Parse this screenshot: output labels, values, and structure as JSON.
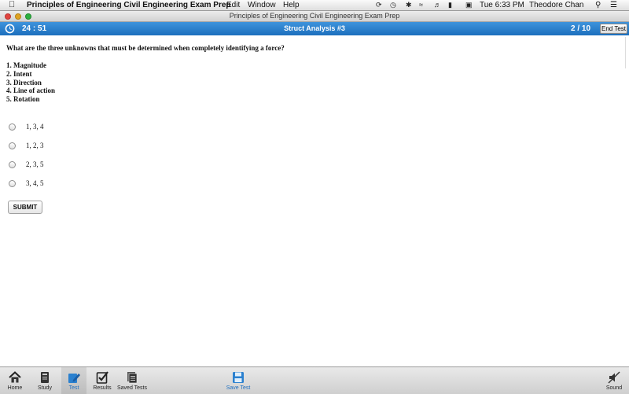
{
  "menubar": {
    "app_name": "Principles of Engineering Civil Engineering Exam Prep",
    "menus": [
      "Edit",
      "Window",
      "Help"
    ],
    "clock": "Tue 6:33 PM",
    "user": "Theodore Chan"
  },
  "window": {
    "title": "Principles of Engineering Civil Engineering Exam Prep"
  },
  "header": {
    "timer": "24 : 51",
    "title": "Struct Analysis #3",
    "progress": "2 / 10",
    "end_test_label": "End Test"
  },
  "question": {
    "text": "What are the three unknowns that must be determined when completely identifying a force?",
    "statements": [
      "1. Magnitude",
      "2. Intent",
      "3. Direction",
      "4. Line of action",
      "5. Rotation"
    ],
    "options": [
      "1, 3, 4",
      "1, 2, 3",
      "2, 3, 5",
      "3, 4, 5"
    ],
    "submit_label": "SUBMIT"
  },
  "toolbar": {
    "home": "Home",
    "study": "Study",
    "test": "Test",
    "results": "Results",
    "saved_tests": "Saved Tests",
    "save_test": "Save Test",
    "sound": "Sound"
  },
  "icons": {
    "apple": "apple-icon",
    "clock": "clock-icon",
    "home": "home-icon",
    "study": "book-icon",
    "test": "pencil-icon",
    "results": "checklist-icon",
    "saved_tests": "documents-icon",
    "save_test": "floppy-icon",
    "sound": "speaker-muted-icon"
  },
  "colors": {
    "header_blue": "#2a80cf",
    "active_blue": "#1f6fc0"
  }
}
